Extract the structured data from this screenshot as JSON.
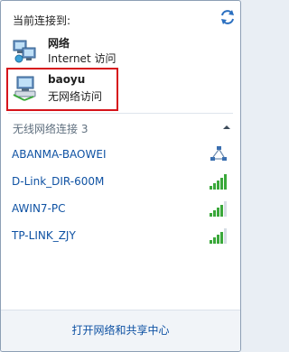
{
  "current": {
    "header": "当前连接到:"
  },
  "connections": [
    {
      "name": "网络",
      "status": "Internet 访问",
      "icon": "network-globe-icon"
    },
    {
      "name": "baoyu",
      "status": "无网络访问",
      "icon": "network-no-access-icon"
    }
  ],
  "wireless": {
    "header": "无线网络连接 3",
    "networks": [
      {
        "ssid": "ABANMA-BAOWEI",
        "icon": "adhoc-network-icon"
      },
      {
        "ssid": "D-Link_DIR-600M",
        "signal_bars": 5
      },
      {
        "ssid": "AWIN7-PC",
        "signal_bars": 4
      },
      {
        "ssid": "TP-LINK_ZJY",
        "signal_bars": 4
      }
    ]
  },
  "footer": {
    "link": "打开网络和共享中心"
  },
  "colors": {
    "link": "#0f52a3",
    "highlight": "#d6141b",
    "signal_green": "#3aa83a"
  }
}
